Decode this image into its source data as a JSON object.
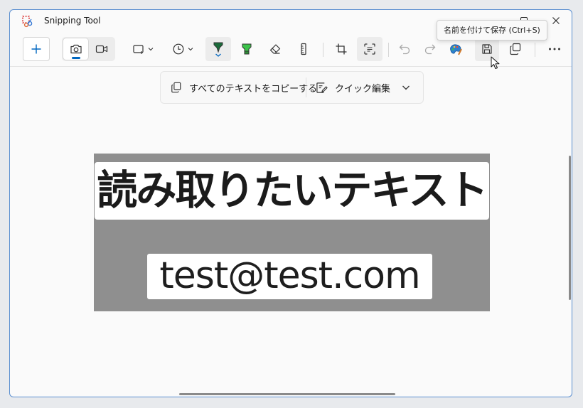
{
  "window": {
    "title": "Snipping Tool",
    "controls": {
      "minimize": "minimize",
      "maximize": "maximize",
      "close": "close"
    }
  },
  "toolbar": {
    "new": "new-snip",
    "mode": [
      "snip-mode-image",
      "snip-mode-video"
    ],
    "active_mode": "snip-mode-image",
    "tools": [
      "snip-shape-rectangle",
      "delay-timer",
      "ballpoint-pen",
      "highlighter",
      "eraser",
      "ruler",
      "crop",
      "text-actions",
      "undo",
      "redo",
      "paint-edit",
      "save",
      "copy",
      "more"
    ],
    "accent": "#0067c0",
    "pen_color": "#1a6b3a",
    "highlighter_color": "#3cc24a"
  },
  "tooltip": {
    "text": "名前を付けて保存 (Ctrl+S)"
  },
  "text_actions": {
    "copy_all": "すべてのテキストをコピーする",
    "quick_edit": "クイック編集"
  },
  "capture": {
    "line1": "読み取りたいテキスト",
    "line2": "test@test.com",
    "background_color": "#8f8f8f"
  }
}
